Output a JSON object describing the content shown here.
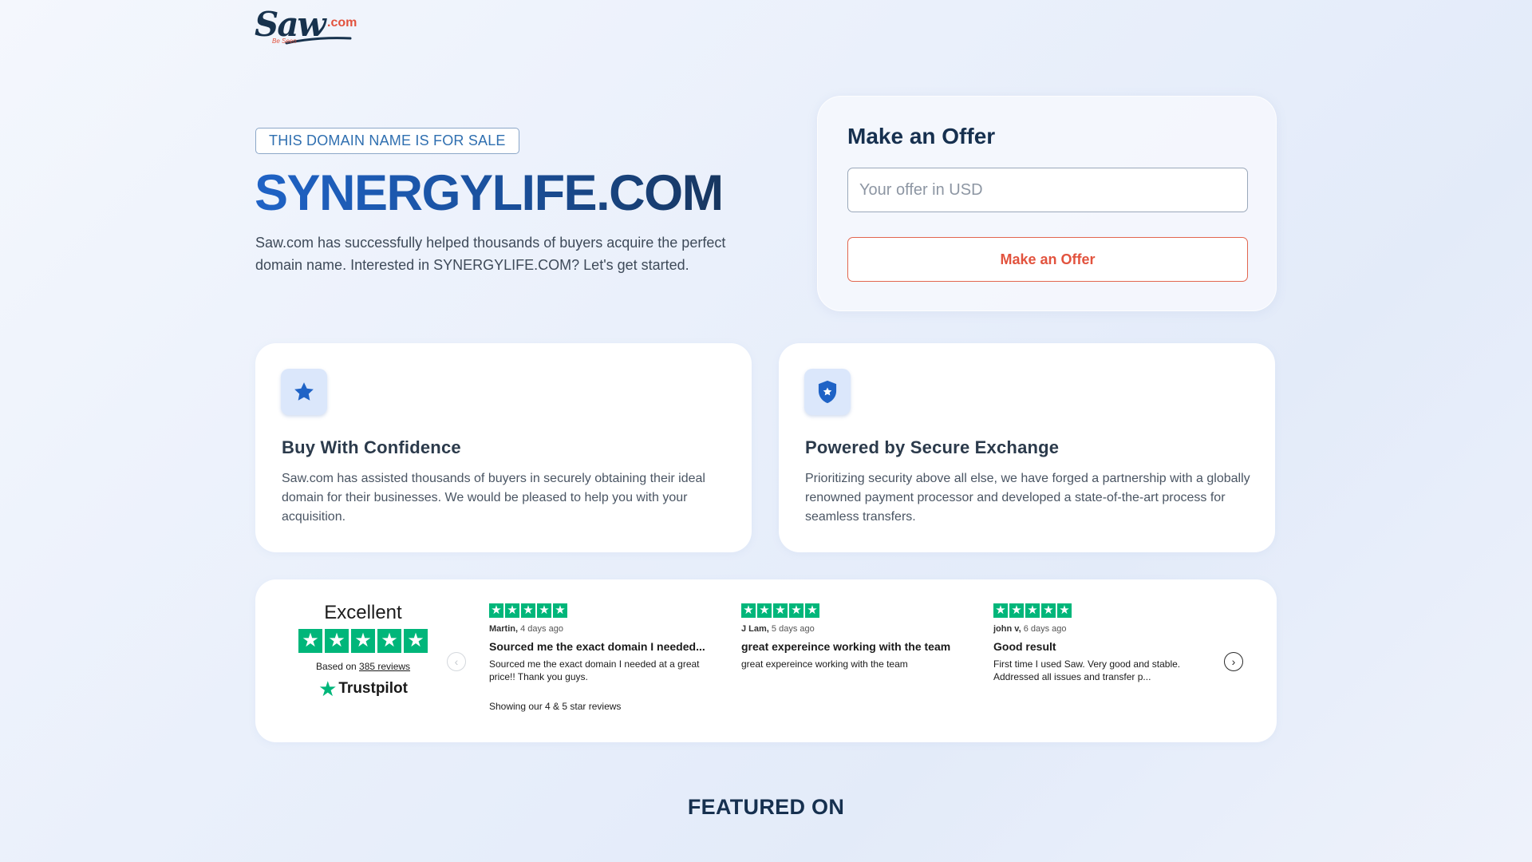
{
  "logo": {
    "main": "Saw",
    "com": ".com",
    "tagline": "Be Seen"
  },
  "hero": {
    "badge": "THIS DOMAIN NAME IS FOR SALE",
    "domain": "SYNERGYLIFE.COM",
    "intro": "Saw.com has successfully helped thousands of buyers acquire the perfect domain name. Interested in SYNERGYLIFE.COM? Let's get started."
  },
  "offer": {
    "title": "Make an Offer",
    "input_placeholder": "Your offer in USD",
    "input_value": "",
    "button_label": "Make an Offer"
  },
  "features": [
    {
      "icon": "star-icon",
      "title": "Buy With Confidence",
      "text": "Saw.com has assisted thousands of buyers in securely obtaining their ideal domain for their businesses. We would be pleased to help you with your acquisition."
    },
    {
      "icon": "shield-icon",
      "title": "Powered by Secure Exchange",
      "text": "Prioritizing security above all else, we have forged a partnership with a globally renowned payment processor and developed a state-of-the-art process for seamless transfers."
    }
  ],
  "trustpilot": {
    "rating_label": "Excellent",
    "stars": 5,
    "based_on_prefix": "Based on",
    "reviews_link": "385 reviews",
    "brand": "Trustpilot",
    "showing": "Showing our 4 & 5 star reviews",
    "reviews": [
      {
        "author": "Martin,",
        "age": "4 days ago",
        "title": "Sourced me the exact domain I needed...",
        "body": "Sourced me the exact domain I needed at a great price!! Thank you guys.",
        "stars": 5
      },
      {
        "author": "J Lam,",
        "age": "5 days ago",
        "title": "great expereince working with the team",
        "body": "great expereince working with the team",
        "stars": 5
      },
      {
        "author": "john v,",
        "age": "6 days ago",
        "title": "Good result",
        "body": "First time I used Saw. Very good and stable. Addressed all issues and transfer p...",
        "stars": 5
      }
    ]
  },
  "featured_heading": "FEATURED ON",
  "colors": {
    "accent_blue": "#1f63c6",
    "accent_orange": "#e2533e",
    "trustpilot_green": "#00b67a",
    "navy": "#16304f"
  }
}
